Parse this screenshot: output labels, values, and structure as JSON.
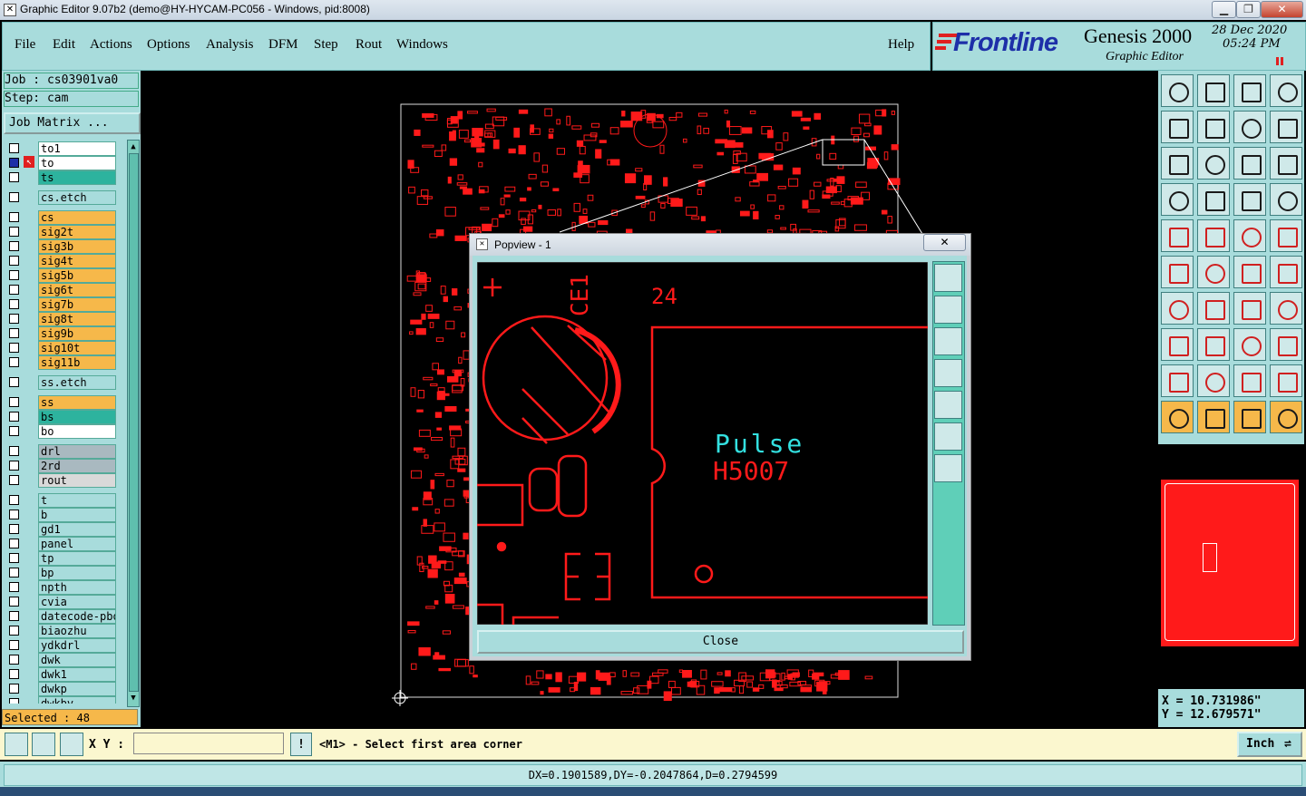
{
  "window": {
    "title": "Graphic Editor 9.07b2 (demo@HY-HYCAM-PC056 - Windows, pid:8008)"
  },
  "menu": {
    "items": [
      "File",
      "Edit",
      "Actions",
      "Options",
      "Analysis",
      "DFM",
      "Step",
      "Rout",
      "Windows"
    ],
    "help": "Help"
  },
  "brand": {
    "logo": "Frontline",
    "product": "Genesis 2000",
    "subtitle": "Graphic Editor",
    "date": "28 Dec 2020",
    "time": "05:24 PM"
  },
  "job": {
    "job_label": "Job : cs03901va0",
    "step_label": "Step: cam",
    "matrix_button": "Job Matrix ..."
  },
  "layers": [
    {
      "name": "to1",
      "color": "#ffffff"
    },
    {
      "name": "to",
      "color": "#ffffff",
      "active": true
    },
    {
      "name": "ts",
      "color": "#2db39e"
    },
    {
      "name": "cs.etch",
      "color": "#a8dcdc"
    },
    {
      "name": "cs",
      "color": "#f6b84a"
    },
    {
      "name": "sig2t",
      "color": "#f6b84a"
    },
    {
      "name": "sig3b",
      "color": "#f6b84a"
    },
    {
      "name": "sig4t",
      "color": "#f6b84a"
    },
    {
      "name": "sig5b",
      "color": "#f6b84a"
    },
    {
      "name": "sig6t",
      "color": "#f6b84a"
    },
    {
      "name": "sig7b",
      "color": "#f6b84a"
    },
    {
      "name": "sig8t",
      "color": "#f6b84a"
    },
    {
      "name": "sig9b",
      "color": "#f6b84a"
    },
    {
      "name": "sig10t",
      "color": "#f6b84a"
    },
    {
      "name": "sig11b",
      "color": "#f6b84a"
    },
    {
      "name": "ss.etch",
      "color": "#a8dcdc"
    },
    {
      "name": "ss",
      "color": "#f6b84a"
    },
    {
      "name": "bs",
      "color": "#2db39e"
    },
    {
      "name": "bo",
      "color": "#ffffff"
    },
    {
      "name": "drl",
      "color": "#a9b9c0"
    },
    {
      "name": "2rd",
      "color": "#a9b9c0"
    },
    {
      "name": "rout",
      "color": "#d9d9d9"
    },
    {
      "name": "t",
      "color": "#a8dcdc"
    },
    {
      "name": "b",
      "color": "#a8dcdc"
    },
    {
      "name": "gd1",
      "color": "#a8dcdc"
    },
    {
      "name": "panel",
      "color": "#a8dcdc"
    },
    {
      "name": "tp",
      "color": "#a8dcdc"
    },
    {
      "name": "bp",
      "color": "#a8dcdc"
    },
    {
      "name": "npth",
      "color": "#a8dcdc"
    },
    {
      "name": "cvia",
      "color": "#a8dcdc"
    },
    {
      "name": "datecode-pbo",
      "color": "#a8dcdc"
    },
    {
      "name": "biaozhu",
      "color": "#a8dcdc"
    },
    {
      "name": "ydkdrl",
      "color": "#a8dcdc"
    },
    {
      "name": "dwk",
      "color": "#a8dcdc"
    },
    {
      "name": "dwk1",
      "color": "#a8dcdc"
    },
    {
      "name": "dwkp",
      "color": "#a8dcdc"
    },
    {
      "name": "dwkbv",
      "color": "#a8dcdc"
    }
  ],
  "selected": "Selected : 48",
  "popview": {
    "title": "Popview - 1",
    "close_button": "Close",
    "labels": {
      "ref": "CE1",
      "num": "24",
      "text1": "Pulse",
      "text2": "H5007"
    }
  },
  "coords": {
    "x": "X = 10.731986\"",
    "y": "Y = 12.679571\""
  },
  "command": {
    "xy_label": "X Y :",
    "xy_value": "",
    "prompt": "<M1> - Select first area corner",
    "units": "Inch"
  },
  "status": {
    "delta": "DX=0.1901589,DY=-0.2047864,D=0.2794599"
  },
  "colors": {
    "panel": "#a8dcdc",
    "accent_orange": "#f6b84a",
    "teal": "#2db39e",
    "pcb_red": "#ff1a1a",
    "text_cyan": "#33e0e0"
  }
}
